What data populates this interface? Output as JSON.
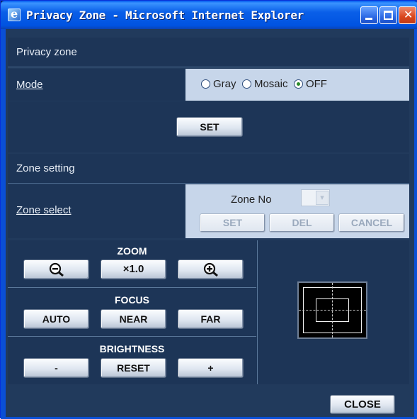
{
  "window": {
    "title": "Privacy Zone - Microsoft Internet Explorer",
    "close_glyph": "✕"
  },
  "privacy": {
    "heading": "Privacy zone",
    "mode_label": "Mode",
    "options": [
      {
        "label": "Gray",
        "selected": false
      },
      {
        "label": "Mosaic",
        "selected": false
      },
      {
        "label": "OFF",
        "selected": true
      }
    ],
    "set_label": "SET"
  },
  "zone": {
    "heading": "Zone setting",
    "select_label": "Zone select",
    "zone_no_label": "Zone No",
    "zone_no_value": "",
    "set_label": "SET",
    "del_label": "DEL",
    "cancel_label": "CANCEL"
  },
  "controls": {
    "zoom_label": "ZOOM",
    "zoom_out_icon": "zoom-out-icon",
    "zoom_value": "×1.0",
    "zoom_in_icon": "zoom-in-icon",
    "focus_label": "FOCUS",
    "focus_auto": "AUTO",
    "focus_near": "NEAR",
    "focus_far": "FAR",
    "brightness_label": "BRIGHTNESS",
    "brightness_minus": "-",
    "brightness_reset": "RESET",
    "brightness_plus": "+"
  },
  "footer": {
    "close_label": "CLOSE"
  }
}
